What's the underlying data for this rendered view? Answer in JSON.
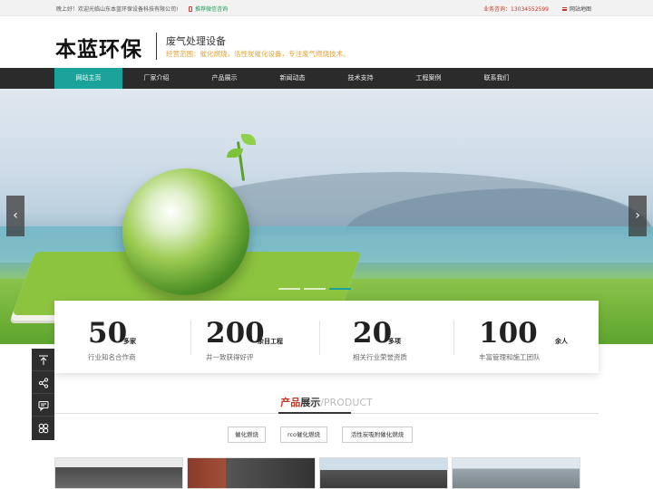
{
  "topbar": {
    "welcome": "晚上好！欢迎光临山东本蓝环保设备科技有限公司!",
    "wechat": "推荐微信咨询",
    "hotline": "业务咨询：13034552599",
    "sitemap": "网站地图"
  },
  "header": {
    "logo": "本蓝环保",
    "tagline": "废气处理设备",
    "scope": "经营范围：催化燃烧，活性炭催化设备，专注废气燃烧技术。"
  },
  "nav": {
    "items": [
      "网站主页",
      "厂家介绍",
      "产品展示",
      "新闻动态",
      "技术支持",
      "工程案例",
      "联系我们"
    ],
    "active_index": 0,
    "active_color": "#1aa39a"
  },
  "banner": {
    "prev": "‹",
    "next": "›",
    "slide_count": 3,
    "active_slide": 2
  },
  "stats": [
    {
      "num": "50",
      "unit": "多家",
      "desc": "行业知名合作商"
    },
    {
      "num": "200",
      "unit": "余目工程",
      "desc": "井一致获得好评"
    },
    {
      "num": "20",
      "unit": "多项",
      "desc": "相关行业荣誉资质"
    },
    {
      "num": "100",
      "unit": "余人",
      "desc": "丰富管理和施工团队"
    }
  ],
  "sidetools": [
    "top-icon",
    "share-icon",
    "message-icon",
    "flower-icon"
  ],
  "products": {
    "title_red": "产品",
    "title_dark": "展示",
    "title_en": "/PRODUCT",
    "categories": [
      "催化燃烧",
      "rco催化燃烧",
      "活性炭吸附催化燃烧"
    ]
  },
  "colors": {
    "accent": "#1aa39a",
    "brand_red": "#c0392b",
    "nav_bg": "#2b2b2b",
    "scope_orange": "#e3a33a"
  }
}
